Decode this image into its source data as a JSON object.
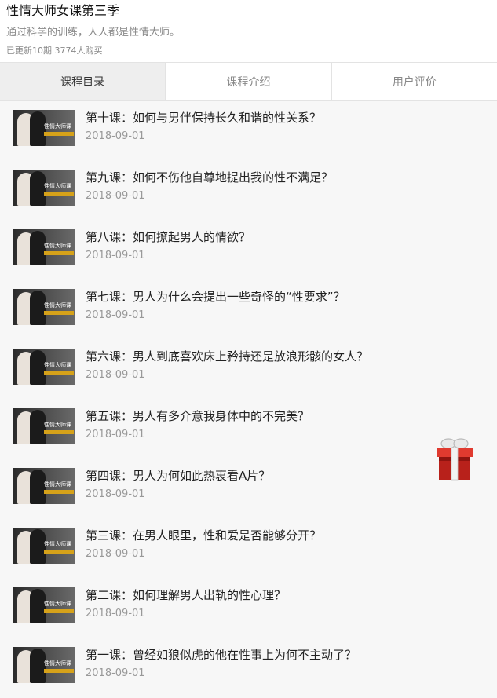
{
  "header": {
    "title": "性情大师女课第三季",
    "subtitle": "通过科学的训练，人人都是性情大师。",
    "meta": "已更新10期 3774人购买"
  },
  "tabs": [
    {
      "label": "课程目录",
      "active": true
    },
    {
      "label": "课程介绍",
      "active": false
    },
    {
      "label": "用户评价",
      "active": false
    }
  ],
  "thumb_caption": "性情大师课",
  "lessons": [
    {
      "title": "第十课：如何与男伴保持长久和谐的性关系？",
      "date": "2018-09-01"
    },
    {
      "title": "第九课：如何不伤他自尊地提出我的性不满足？",
      "date": "2018-09-01"
    },
    {
      "title": "第八课：如何撩起男人的情欲？",
      "date": "2018-09-01"
    },
    {
      "title": "第七课：男人为什么会提出一些奇怪的“性要求”？",
      "date": "2018-09-01"
    },
    {
      "title": "第六课：男人到底喜欢床上矜持还是放浪形骸的女人？",
      "date": "2018-09-01"
    },
    {
      "title": "第五课：男人有多介意我身体中的不完美？",
      "date": "2018-09-01"
    },
    {
      "title": "第四课：男人为何如此热衷看A片？",
      "date": "2018-09-01"
    },
    {
      "title": "第三课：在男人眼里，性和爱是否能够分开？",
      "date": "2018-09-01"
    },
    {
      "title": "第二课：如何理解男人出轨的性心理？",
      "date": "2018-09-01"
    },
    {
      "title": "第一课：曾经如狼似虎的他在性事上为何不主动了？",
      "date": "2018-09-01"
    }
  ],
  "floating": {
    "icon": "gift-icon",
    "color": "#d0302a"
  }
}
